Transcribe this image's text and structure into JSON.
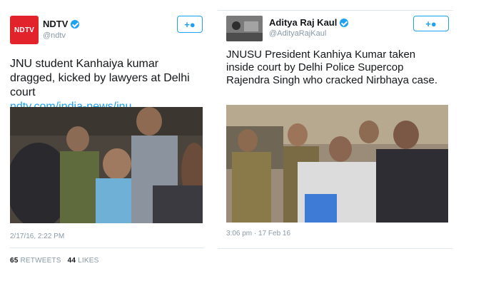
{
  "tweet_left": {
    "author_name": "NDTV",
    "handle": "@ndtv",
    "avatar_label": "NDTV",
    "text": "JNU student Kanhaiya kumar dragged, kicked by lawyers at Delhi court",
    "link": "ndtv.com/india-news/jnu...",
    "timestamp": "2/17/16, 2:22 PM",
    "retweets_count": "65",
    "retweets_label": "RETWEETS",
    "likes_count": "44",
    "likes_label": "LIKES",
    "follow_icon": "person-plus-icon",
    "verified_icon": "verified-icon"
  },
  "tweet_right": {
    "author_name": "Aditya Raj Kaul",
    "handle": "@AdityaRajKaul",
    "text": "JNUSU President Kanhiya Kumar taken inside court by Delhi Police Supercop Rajendra Singh who cracked Nirbhaya case.",
    "timestamp": "3:06 pm · 17 Feb 16",
    "follow_icon": "person-plus-icon",
    "verified_icon": "verified-icon"
  },
  "colors": {
    "accent": "#1da1f2",
    "ndtv_red": "#e3232c",
    "muted": "#8899a6",
    "divider": "#e1e8ed"
  }
}
